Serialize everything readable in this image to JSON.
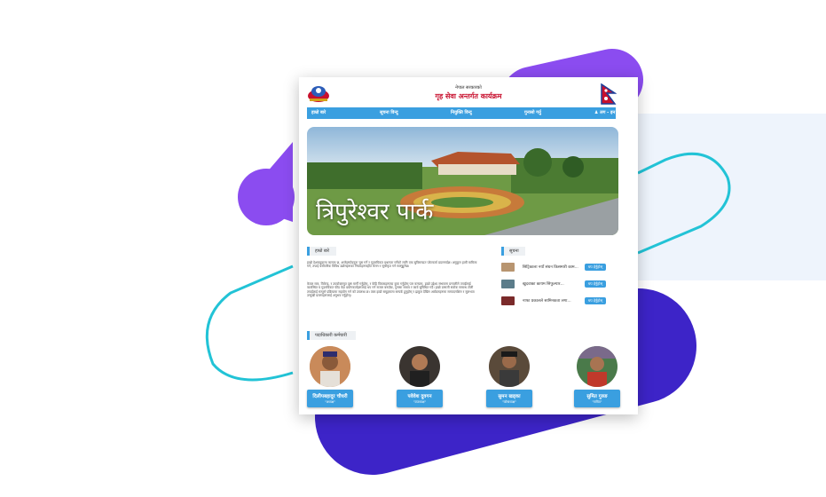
{
  "header": {
    "subtitle": "नेपाल सरकारको",
    "title": "गृह सेवा अन्तर्गत कार्यक्रम"
  },
  "nav": {
    "items": [
      "हाम्रो बारे",
      "सूचना विन्दु",
      "नियुक्ति विन्दु",
      "गुनासो गर्नुु"
    ],
    "login": "लग - इन"
  },
  "hero": {
    "caption": "त्रिपुरेश्वर पार्क"
  },
  "about": {
    "label": "हाम्रो बारे",
    "para1": "हाम्रो देशमाहुदाला कागता छ, अन्तेद्दस्पोदनुता चुस गर्ने र गुदमयिकत प्रधानता गर्नेको लागि एक सुविसन्दात प्लेटफर्मा प्रदानगर्दछ। अनुकूल हामी मामिला गर्न, तपाई यस्तैतरिक विविध उद्योगहरूका नियमहरूमहीत मेलन र सूचीकृत गर्न सक्नुहुनेछ।",
    "para2": "केवल मात्र, विकेन्द्र, र उपयोक्तसुत दृष्टा मार्गी गर्नुहोस्, र केहि विकसहरूल्दा कुक गर्नुहोस् पल कन्यला, हाम्रो उद्देश्य संभावना प्रणालीले तपाईंलाई व्यवस्थित य गुदमयिकत फीड वेदा प्रयोगकर्ताहरूलाई थप गर्न सजल बनाउँछ, गुनासा समाव र कार्य सुविधित गर्दै। हाम्रो प्रणाली सवोक सम्बन्ध टोली तपाईलाई सम्पूर्ण प्रक्रियामा सहयोग गर्न को उपलब्ध छ। त्यस हाम्रो समूहमाला सम्पर्क हुनुहोस् र झकुम देखिन आवेदनहरूमा सम्पादनशिल र सुलभता उन्मुखी प्रमाणहरूलाई अनुभव गर्नुहोस्।"
  },
  "notices": {
    "label": "सूचना",
    "items": [
      {
        "text": "सिट्रिकाला नयाँ संघन किसमारी काम...",
        "button": "थप हेर्नुहोस्"
      },
      {
        "text": "खुदवाका कायम सिफुल्यार...",
        "button": "थप हेर्नुहोस्"
      },
      {
        "text": "नाफा प्रकालले सामिनकता लगा...",
        "button": "थप हेर्नुहोस्"
      }
    ]
  },
  "staff": {
    "label": "पदाधिकारी कर्मचारी",
    "members": [
      {
        "name": "दिलीपबहादुर चौधरी",
        "role": "\"अध्यक्ष\""
      },
      {
        "name": "पवेवेश दुवगन",
        "role": "\"उपाध्यक्ष\""
      },
      {
        "name": "सुमन खड्का",
        "role": "\"कोषाध्यक्ष\""
      },
      {
        "name": "सुमित गुरुङ",
        "role": "\"सचिव\""
      }
    ]
  },
  "colors": {
    "accent": "#3a9fe0",
    "brand_red": "#c8102e",
    "purple": "#8b4cf0",
    "indigo": "#3d24c8",
    "cyan": "#22c3d6"
  }
}
